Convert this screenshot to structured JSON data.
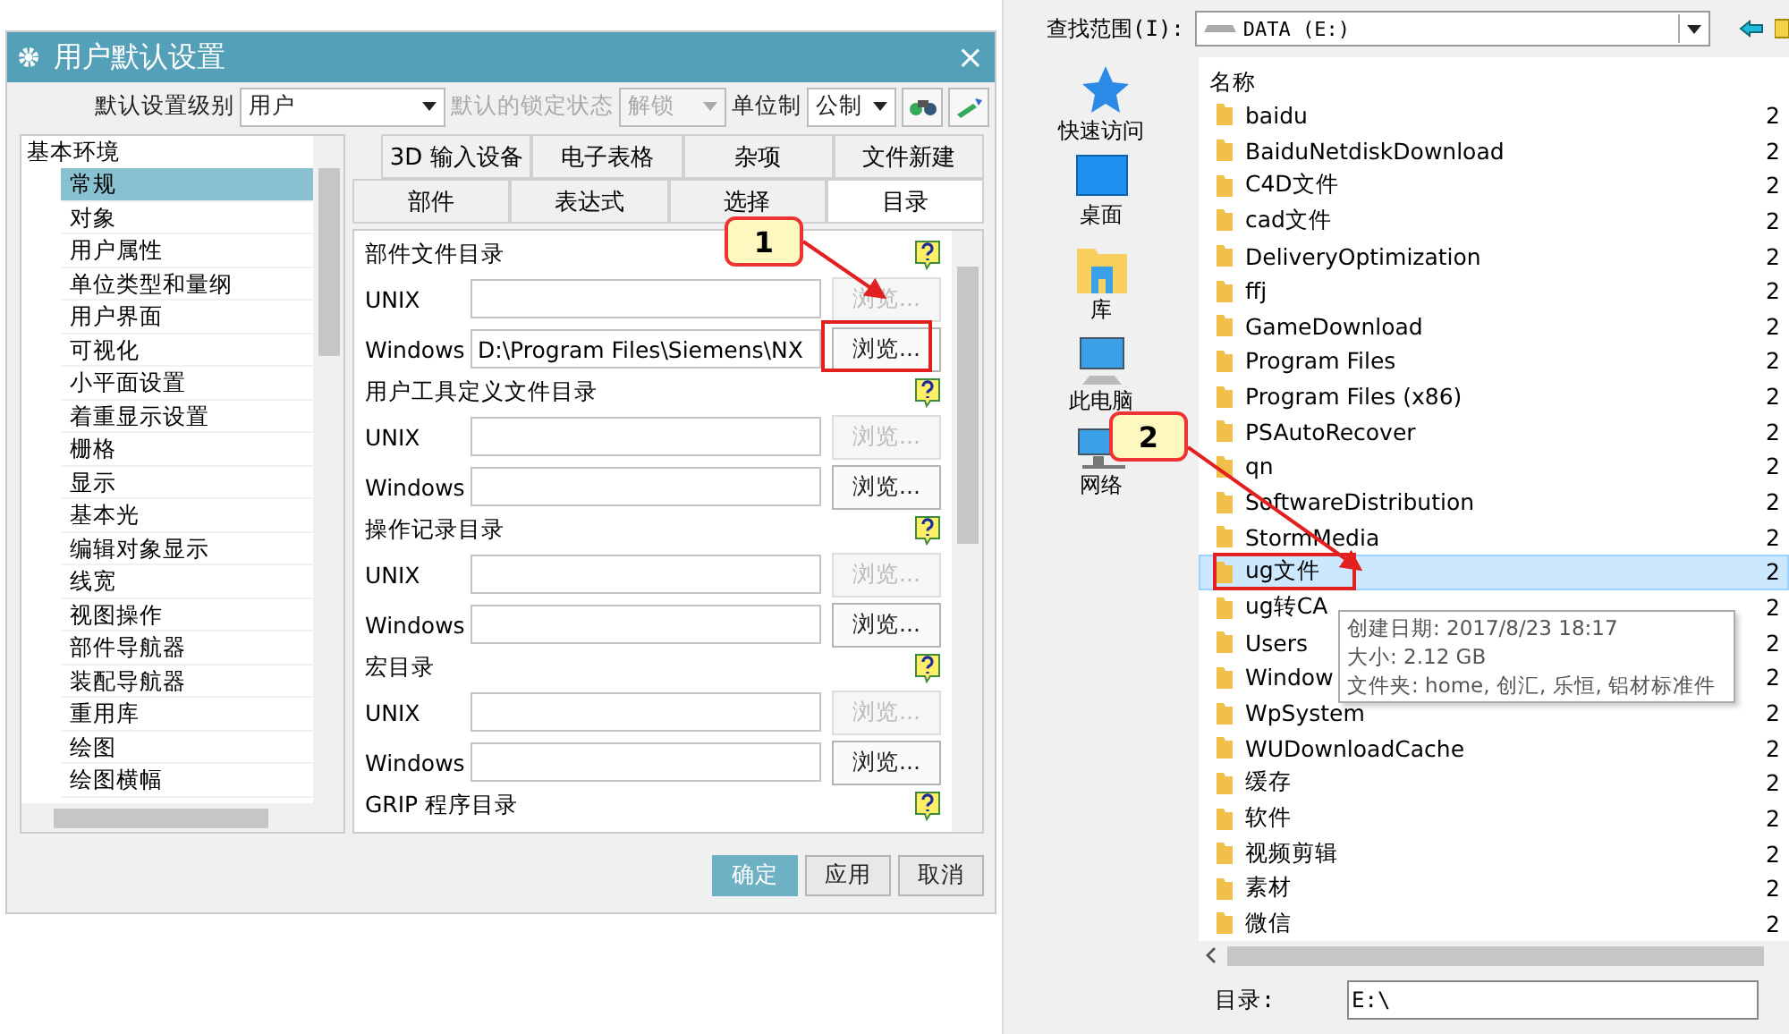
{
  "settings_dialog": {
    "title": "用户默认设置",
    "close": "×",
    "toolbar": {
      "level_label": "默认设置级别",
      "level_value": "用户",
      "lock_label": "默认的锁定状态",
      "lock_value": "解锁",
      "lock_disabled": true,
      "unit_label": "单位制",
      "unit_value": "公制"
    },
    "tree": {
      "root": "基本环境",
      "children": [
        {
          "label": "常规",
          "selected": true
        },
        {
          "label": "对象",
          "selected": false
        },
        {
          "label": "用户属性",
          "selected": false
        },
        {
          "label": "单位类型和量纲",
          "selected": false
        },
        {
          "label": "用户界面",
          "selected": false
        },
        {
          "label": "可视化",
          "selected": false
        },
        {
          "label": "小平面设置",
          "selected": false
        },
        {
          "label": "着重显示设置",
          "selected": false
        },
        {
          "label": "栅格",
          "selected": false
        },
        {
          "label": "显示",
          "selected": false
        },
        {
          "label": "基本光",
          "selected": false
        },
        {
          "label": "编辑对象显示",
          "selected": false
        },
        {
          "label": "线宽",
          "selected": false
        },
        {
          "label": "视图操作",
          "selected": false
        },
        {
          "label": "部件导航器",
          "selected": false
        },
        {
          "label": "装配导航器",
          "selected": false
        },
        {
          "label": "重用库",
          "selected": false
        },
        {
          "label": "绘图",
          "selected": false
        },
        {
          "label": "绘图横幅",
          "selected": false
        }
      ]
    },
    "tab_rows": [
      [
        {
          "label": "3D 输入设备",
          "selected": false
        },
        {
          "label": "电子表格",
          "selected": false
        },
        {
          "label": "杂项",
          "selected": false
        },
        {
          "label": "文件新建",
          "selected": false
        }
      ],
      [
        {
          "label": "部件",
          "selected": false
        },
        {
          "label": "表达式",
          "selected": false
        },
        {
          "label": "选择",
          "selected": false
        },
        {
          "label": "目录",
          "selected": true
        }
      ]
    ],
    "sections": [
      {
        "title": "部件文件目录",
        "rows": [
          {
            "label": "UNIX",
            "value": "",
            "button": "浏览...",
            "disabled": true
          },
          {
            "label": "Windows",
            "value": "D:\\Program Files\\Siemens\\NX",
            "button": "浏览...",
            "disabled": false
          }
        ]
      },
      {
        "title": "用户工具定义文件目录",
        "rows": [
          {
            "label": "UNIX",
            "value": "",
            "button": "浏览...",
            "disabled": true
          },
          {
            "label": "Windows",
            "value": "",
            "button": "浏览...",
            "disabled": false
          }
        ]
      },
      {
        "title": "操作记录目录",
        "rows": [
          {
            "label": "UNIX",
            "value": "",
            "button": "浏览...",
            "disabled": true
          },
          {
            "label": "Windows",
            "value": "",
            "button": "浏览...",
            "disabled": false
          }
        ]
      },
      {
        "title": "宏目录",
        "rows": [
          {
            "label": "UNIX",
            "value": "",
            "button": "浏览...",
            "disabled": true
          },
          {
            "label": "Windows",
            "value": "",
            "button": "浏览...",
            "disabled": false
          }
        ]
      },
      {
        "title": "GRIP 程序目录"
      }
    ],
    "buttons": [
      {
        "label": "确定",
        "kind": "primary"
      },
      {
        "label": "应用",
        "kind": "normal"
      },
      {
        "label": "取消",
        "kind": "normal"
      }
    ]
  },
  "file_dialog": {
    "lookin_label": "查找范围(I):",
    "lookin_value": "DATA (E:)",
    "places": [
      {
        "label": "快速访问",
        "kind": "star"
      },
      {
        "label": "桌面",
        "kind": "desktop"
      },
      {
        "label": "库",
        "kind": "library"
      },
      {
        "label": "此电脑",
        "kind": "computer"
      },
      {
        "label": "网络",
        "kind": "network"
      }
    ],
    "name_header": "名称",
    "rows": [
      {
        "name": "baidu",
        "date": "2",
        "selected": false
      },
      {
        "name": "BaiduNetdiskDownload",
        "date": "2",
        "selected": false
      },
      {
        "name": "C4D文件",
        "date": "2",
        "selected": false
      },
      {
        "name": "cad文件",
        "date": "2",
        "selected": false
      },
      {
        "name": "DeliveryOptimization",
        "date": "2",
        "selected": false
      },
      {
        "name": "ffj",
        "date": "2",
        "selected": false
      },
      {
        "name": "GameDownload",
        "date": "2",
        "selected": false
      },
      {
        "name": "Program Files",
        "date": "2",
        "selected": false
      },
      {
        "name": "Program Files (x86)",
        "date": "2",
        "selected": false
      },
      {
        "name": "PSAutoRecover",
        "date": "2",
        "selected": false
      },
      {
        "name": "qn",
        "date": "2",
        "selected": false
      },
      {
        "name": "SoftwareDistribution",
        "date": "2",
        "selected": false
      },
      {
        "name": "StormMedia",
        "date": "2",
        "selected": false
      },
      {
        "name": "ug文件",
        "date": "2",
        "selected": true
      },
      {
        "name": "ug转CA",
        "date": "2",
        "selected": false
      },
      {
        "name": "Users",
        "date": "2",
        "selected": false
      },
      {
        "name": "Window",
        "date": "2",
        "selected": false
      },
      {
        "name": "WpSystem",
        "date": "2",
        "selected": false
      },
      {
        "name": "WUDownloadCache",
        "date": "2",
        "selected": false
      },
      {
        "name": "缓存",
        "date": "2",
        "selected": false
      },
      {
        "name": "软件",
        "date": "2",
        "selected": false
      },
      {
        "name": "视频剪辑",
        "date": "2",
        "selected": false
      },
      {
        "name": "素材",
        "date": "2",
        "selected": false
      },
      {
        "name": "微信",
        "date": "2",
        "selected": false
      }
    ],
    "dir_label": "目录:",
    "dir_value": "E:\\"
  },
  "tooltip": {
    "lines": [
      "创建日期: 2017/8/23 18:17",
      "大小: 2.12 GB",
      "文件夹: home, 创汇, 乐恒, 铝材标准件"
    ]
  },
  "callouts": [
    {
      "label": "1"
    },
    {
      "label": "2"
    }
  ]
}
